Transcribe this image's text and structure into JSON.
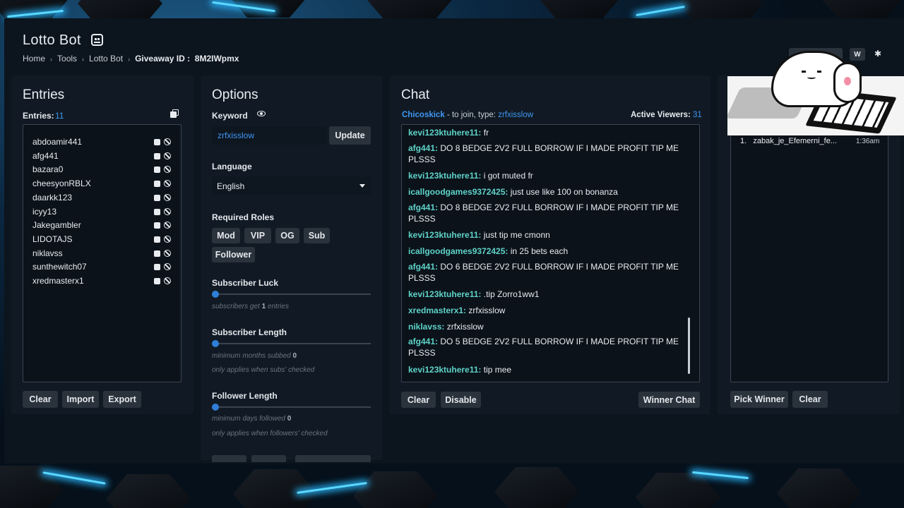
{
  "app": {
    "title": "Lotto Bot"
  },
  "breadcrumb": {
    "home": "Home",
    "tools": "Tools",
    "lotto": "Lotto Bot",
    "giveaway_label": "Giveaway ID :",
    "giveaway_id": "8M2IWpmx"
  },
  "top_right": {
    "w_label": "W",
    "star": "✱"
  },
  "entries": {
    "heading": "Entries",
    "count_label": "Entries:",
    "count": "11",
    "list": [
      "abdoamir441",
      "afg441",
      "bazara0",
      "cheesyonRBLX",
      "daarkk123",
      "icyy13",
      "Jakegambler",
      "LIDOTAJS",
      "niklavss",
      "sunthewitch07",
      "xredmasterx1"
    ],
    "clear": "Clear",
    "import": "Import",
    "export": "Export"
  },
  "options": {
    "heading": "Options",
    "keyword_label": "Keyword",
    "keyword_value": "zrfxisslow",
    "update": "Update",
    "language_label": "Language",
    "language_value": "English",
    "roles_label": "Required Roles",
    "roles": [
      "Mod",
      "VIP",
      "OG",
      "Sub",
      "Follower"
    ],
    "sub_luck_label": "Subscriber Luck",
    "sub_luck_hint_pre": "subscribers get",
    "sub_luck_value": "1",
    "sub_luck_hint_post": "entries",
    "sub_length_label": "Subscriber Length",
    "sub_length_hint": "minimum months subbed",
    "sub_length_value": "0",
    "sub_length_note": "only applies when subs' checked",
    "follow_length_label": "Follower Length",
    "follow_length_hint": "minimum days followed",
    "follow_length_value": "0",
    "follow_length_note": "only applies when followers' checked"
  },
  "chat": {
    "heading": "Chat",
    "channel": "Chicoskick",
    "join_text": "- to join, type:",
    "join_keyword": "zrfxisslow",
    "viewers_label": "Active Viewers:",
    "viewers": "31",
    "messages": [
      {
        "user": "kevi123ktuhere11:",
        "text": "fr"
      },
      {
        "user": "afg441:",
        "text": "DO 8 BEDGE 2V2 FULL BORROW IF I MADE PROFIT TIP ME PLSSS"
      },
      {
        "user": "kevi123ktuhere11:",
        "text": "i got muted fr"
      },
      {
        "user": "icallgoodgames9372425:",
        "text": "just use like 100 on bonanza"
      },
      {
        "user": "afg441:",
        "text": "DO 8 BEDGE 2V2 FULL BORROW IF I MADE PROFIT TIP ME PLSSS"
      },
      {
        "user": "kevi123ktuhere11:",
        "text": "just tip me cmonn"
      },
      {
        "user": "icallgoodgames9372425:",
        "text": "in 25 bets each"
      },
      {
        "user": "afg441:",
        "text": "DO 6 BEDGE 2V2 FULL BORROW IF I MADE PROFIT TIP ME PLSSS"
      },
      {
        "user": "kevi123ktuhere11:",
        "text": ".tip Zorro1ww1"
      },
      {
        "user": "xredmasterx1:",
        "text": "zrfxisslow"
      },
      {
        "user": "niklavss:",
        "text": "zrfxisslow"
      },
      {
        "user": "afg441:",
        "text": "DO 5 BEDGE 2V2 FULL BORROW IF I MADE PROFIT TIP ME PLSSS"
      },
      {
        "user": "kevi123ktuhere11:",
        "text": "tip mee"
      }
    ],
    "clear": "Clear",
    "disable": "Disable",
    "winner_chat": "Winner Chat"
  },
  "winners": {
    "list": [
      {
        "rank": "1.",
        "name": "zabak_je_Efemerni_fe...",
        "time": "1:36am"
      }
    ],
    "pick": "Pick Winner",
    "clear": "Clear"
  },
  "colors": {
    "accent": "#3f96f2",
    "chat_user": "#5fd3c8",
    "panel": "#111a24"
  }
}
